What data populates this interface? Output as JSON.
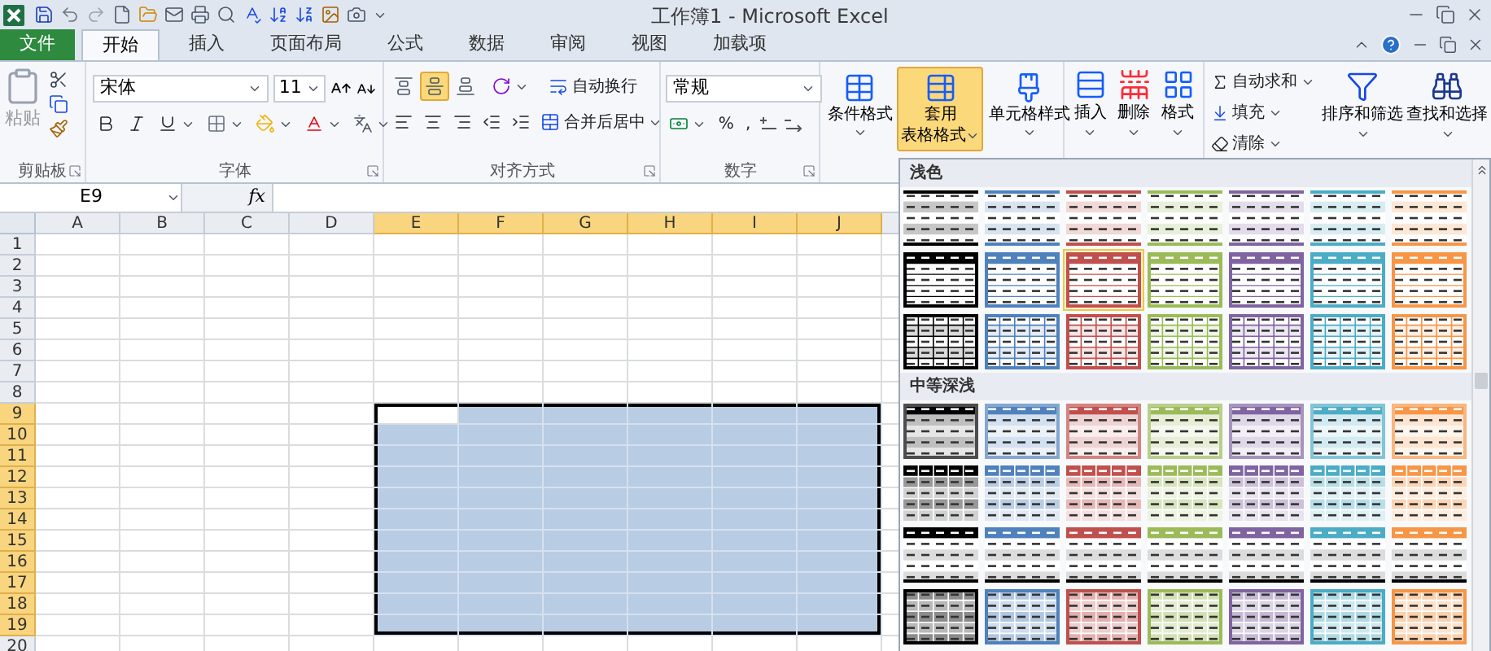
{
  "window": {
    "title": "工作簿1 - Microsoft Excel"
  },
  "tabs": [
    {
      "label": "文件",
      "kind": "file",
      "selected": false
    },
    {
      "label": "开始",
      "kind": "tab",
      "selected": true
    },
    {
      "label": "插入",
      "kind": "tab",
      "selected": false
    },
    {
      "label": "页面布局",
      "kind": "tab",
      "selected": false
    },
    {
      "label": "公式",
      "kind": "tab",
      "selected": false
    },
    {
      "label": "数据",
      "kind": "tab",
      "selected": false
    },
    {
      "label": "审阅",
      "kind": "tab",
      "selected": false
    },
    {
      "label": "视图",
      "kind": "tab",
      "selected": false
    },
    {
      "label": "加载项",
      "kind": "tab",
      "selected": false
    }
  ],
  "ribbon": {
    "clipboard": {
      "paste": "粘贴",
      "paste_disabled": true,
      "label": "剪贴板"
    },
    "font": {
      "name": "宋体",
      "size": "11",
      "label": "字体"
    },
    "alignment": {
      "vertical": [
        {
          "selected": false
        },
        {
          "selected": true
        },
        {
          "selected": false
        }
      ],
      "wrap": "自动换行",
      "merge": "合并后居中",
      "label": "对齐方式"
    },
    "number": {
      "format": "常规",
      "percent": "%",
      "comma": ",",
      "label": "数字"
    },
    "styles": [
      {
        "lines": [
          "条件格式"
        ],
        "selected": false
      },
      {
        "lines": [
          "套用",
          "表格格式"
        ],
        "selected": true
      },
      {
        "lines": [
          "单元格样式"
        ],
        "selected": false
      }
    ],
    "cells": [
      {
        "label": "插入"
      },
      {
        "label": "删除"
      },
      {
        "label": "格式"
      }
    ],
    "editing": {
      "autosum": "自动求和",
      "fill": "填充",
      "clear": "清除",
      "sort": "排序和筛选",
      "find": "查找和选择"
    }
  },
  "formula_bar": {
    "name_box": "E9",
    "function_label": "fx"
  },
  "sheet": {
    "columns": [
      {
        "label": "A",
        "selected": false
      },
      {
        "label": "B",
        "selected": false
      },
      {
        "label": "C",
        "selected": false
      },
      {
        "label": "D",
        "selected": false
      },
      {
        "label": "E",
        "selected": true
      },
      {
        "label": "F",
        "selected": true
      },
      {
        "label": "G",
        "selected": true
      },
      {
        "label": "H",
        "selected": true
      },
      {
        "label": "I",
        "selected": true
      },
      {
        "label": "J",
        "selected": true
      }
    ],
    "rows": [
      {
        "label": "1",
        "selected": false
      },
      {
        "label": "2",
        "selected": false
      },
      {
        "label": "3",
        "selected": false
      },
      {
        "label": "4",
        "selected": false
      },
      {
        "label": "5",
        "selected": false
      },
      {
        "label": "6",
        "selected": false
      },
      {
        "label": "7",
        "selected": false
      },
      {
        "label": "8",
        "selected": false
      },
      {
        "label": "9",
        "selected": true
      },
      {
        "label": "10",
        "selected": true
      },
      {
        "label": "11",
        "selected": true
      },
      {
        "label": "12",
        "selected": true
      },
      {
        "label": "13",
        "selected": true
      },
      {
        "label": "14",
        "selected": true
      },
      {
        "label": "15",
        "selected": true
      },
      {
        "label": "16",
        "selected": true
      },
      {
        "label": "17",
        "selected": true
      },
      {
        "label": "18",
        "selected": true
      },
      {
        "label": "19",
        "selected": true
      },
      {
        "label": "20",
        "selected": false
      }
    ]
  },
  "gallery": {
    "sections": [
      {
        "title": "浅色",
        "rows": [
          {
            "kind": "light-banded",
            "items": [
              {
                "color": "#000000",
                "selected": false
              },
              {
                "color": "#4f81bd",
                "selected": false
              },
              {
                "color": "#c0504d",
                "selected": false
              },
              {
                "color": "#9bbb59",
                "selected": false
              },
              {
                "color": "#8064a2",
                "selected": false
              },
              {
                "color": "#4bacc6",
                "selected": false
              },
              {
                "color": "#f79646",
                "selected": false
              }
            ]
          },
          {
            "kind": "light-header",
            "items": [
              {
                "color": "#000000",
                "selected": false
              },
              {
                "color": "#4f81bd",
                "selected": false
              },
              {
                "color": "#c0504d",
                "selected": true
              },
              {
                "color": "#9bbb59",
                "selected": false
              },
              {
                "color": "#8064a2",
                "selected": false
              },
              {
                "color": "#4bacc6",
                "selected": false
              },
              {
                "color": "#f79646",
                "selected": false
              }
            ]
          },
          {
            "kind": "light-grid",
            "items": [
              {
                "color": "#000000",
                "selected": false
              },
              {
                "color": "#4f81bd",
                "selected": false
              },
              {
                "color": "#c0504d",
                "selected": false
              },
              {
                "color": "#9bbb59",
                "selected": false
              },
              {
                "color": "#8064a2",
                "selected": false
              },
              {
                "color": "#4bacc6",
                "selected": false
              },
              {
                "color": "#f79646",
                "selected": false
              }
            ]
          }
        ]
      },
      {
        "title": "中等深浅",
        "rows": [
          {
            "kind": "medium-header",
            "items": [
              {
                "color": "#000000",
                "selected": false
              },
              {
                "color": "#4f81bd",
                "selected": false
              },
              {
                "color": "#c0504d",
                "selected": false
              },
              {
                "color": "#9bbb59",
                "selected": false
              },
              {
                "color": "#8064a2",
                "selected": false
              },
              {
                "color": "#4bacc6",
                "selected": false
              },
              {
                "color": "#f79646",
                "selected": false
              }
            ]
          },
          {
            "kind": "medium-header-grid",
            "items": [
              {
                "color": "#000000",
                "selected": false
              },
              {
                "color": "#4f81bd",
                "selected": false
              },
              {
                "color": "#c0504d",
                "selected": false
              },
              {
                "color": "#9bbb59",
                "selected": false
              },
              {
                "color": "#8064a2",
                "selected": false
              },
              {
                "color": "#4bacc6",
                "selected": false
              },
              {
                "color": "#f79646",
                "selected": false
              }
            ]
          },
          {
            "kind": "medium-rule",
            "items": [
              {
                "color": "#000000",
                "selected": false
              },
              {
                "color": "#4f81bd",
                "selected": false
              },
              {
                "color": "#c0504d",
                "selected": false
              },
              {
                "color": "#9bbb59",
                "selected": false
              },
              {
                "color": "#8064a2",
                "selected": false
              },
              {
                "color": "#4bacc6",
                "selected": false
              },
              {
                "color": "#f79646",
                "selected": false
              }
            ]
          },
          {
            "kind": "medium-tinted",
            "items": [
              {
                "color": "#000000",
                "selected": false
              },
              {
                "color": "#4f81bd",
                "selected": false
              },
              {
                "color": "#c0504d",
                "selected": false
              },
              {
                "color": "#9bbb59",
                "selected": false
              },
              {
                "color": "#8064a2",
                "selected": false
              },
              {
                "color": "#4bacc6",
                "selected": false
              },
              {
                "color": "#f79646",
                "selected": false
              }
            ]
          }
        ]
      }
    ]
  }
}
